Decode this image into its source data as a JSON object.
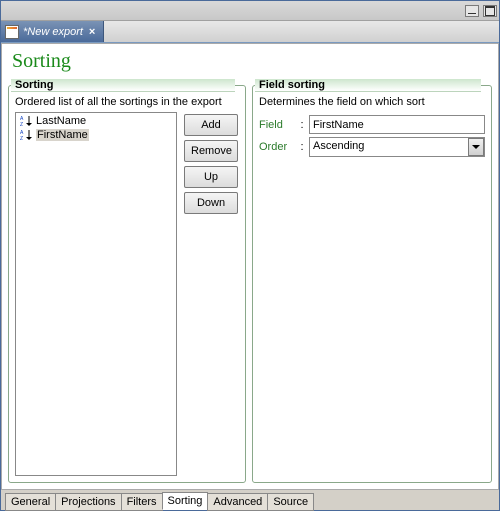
{
  "window": {
    "tab_title": "*New export"
  },
  "page": {
    "title": "Sorting"
  },
  "left_panel": {
    "title": "Sorting",
    "description": "Ordered list of all the sortings in the export",
    "items": [
      {
        "label": "LastName"
      },
      {
        "label": "FirstName"
      }
    ],
    "buttons": {
      "add": "Add",
      "remove": "Remove",
      "up": "Up",
      "down": "Down"
    }
  },
  "right_panel": {
    "title": "Field sorting",
    "description": "Determines the field on which sort",
    "field_label": "Field",
    "field_value": "FirstName",
    "order_label": "Order",
    "order_value": "Ascending"
  },
  "bottom_tabs": [
    "General",
    "Projections",
    "Filters",
    "Sorting",
    "Advanced",
    "Source"
  ],
  "active_bottom_tab": 3,
  "selected_item_index": 1
}
